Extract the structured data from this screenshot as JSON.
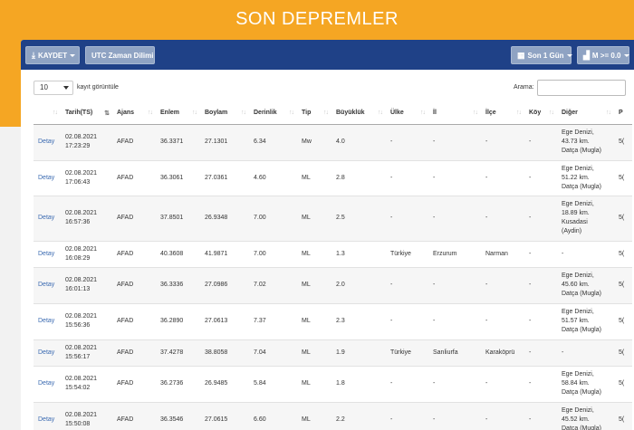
{
  "page_title": "SON DEPREMLER",
  "colors": {
    "header_bg": "#f5a623",
    "toolbar_bg": "#1f4187",
    "button_bg": "#8fa3c3",
    "link": "#3a6ab1"
  },
  "toolbar": {
    "save_label": "KAYDET",
    "save_icon": "download-icon",
    "utc_label": "UTC Zaman Dilimi",
    "period_label": "Son 1 Gün",
    "period_icon": "calendar-icon",
    "magnitude_label": "M >= 0.0",
    "magnitude_icon": "bar-chart-icon"
  },
  "controls": {
    "page_length": "10",
    "page_length_suffix": "kayıt görüntüle",
    "search_label": "Arama:",
    "search_value": ""
  },
  "columns": [
    "",
    "Tarih(TS)",
    "Ajans",
    "Enlem",
    "Boylam",
    "Derinlik",
    "Tip",
    "Büyüklük",
    "Ülke",
    "İl",
    "İlçe",
    "Köy",
    "Diğer",
    "P"
  ],
  "rows": [
    {
      "link": "Detay",
      "date": "02.08.2021",
      "time": "17:23:29",
      "agency": "AFAD",
      "lat": "36.3371",
      "lon": "27.1301",
      "depth": "6.34",
      "type": "Mw",
      "mag": "4.0",
      "country": "-",
      "city": "-",
      "district": "-",
      "village": "-",
      "other": [
        "Ege Denizi,",
        "43.73 km.",
        "Datça (Mugla)"
      ],
      "p": "5("
    },
    {
      "link": "Detay",
      "date": "02.08.2021",
      "time": "17:06:43",
      "agency": "AFAD",
      "lat": "36.3061",
      "lon": "27.0361",
      "depth": "4.60",
      "type": "ML",
      "mag": "2.8",
      "country": "-",
      "city": "-",
      "district": "-",
      "village": "-",
      "other": [
        "Ege Denizi,",
        "51.22 km.",
        "Datça (Mugla)"
      ],
      "p": "5("
    },
    {
      "link": "Detay",
      "date": "02.08.2021",
      "time": "16:57:36",
      "agency": "AFAD",
      "lat": "37.8501",
      "lon": "26.9348",
      "depth": "7.00",
      "type": "ML",
      "mag": "2.5",
      "country": "-",
      "city": "-",
      "district": "-",
      "village": "-",
      "other": [
        "Ege Denizi,",
        "18.89 km.",
        "Kusadasi",
        "(Aydin)"
      ],
      "p": "5("
    },
    {
      "link": "Detay",
      "date": "02.08.2021",
      "time": "16:08:29",
      "agency": "AFAD",
      "lat": "40.3608",
      "lon": "41.9871",
      "depth": "7.00",
      "type": "ML",
      "mag": "1.3",
      "country": "Türkiye",
      "city": "Erzurum",
      "district": "Narman",
      "village": "-",
      "other": [
        "-"
      ],
      "p": "5("
    },
    {
      "link": "Detay",
      "date": "02.08.2021",
      "time": "16:01:13",
      "agency": "AFAD",
      "lat": "36.3336",
      "lon": "27.0986",
      "depth": "7.02",
      "type": "ML",
      "mag": "2.0",
      "country": "-",
      "city": "-",
      "district": "-",
      "village": "-",
      "other": [
        "Ege Denizi,",
        "45.60 km.",
        "Datça (Mugla)"
      ],
      "p": "5("
    },
    {
      "link": "Detay",
      "date": "02.08.2021",
      "time": "15:56:36",
      "agency": "AFAD",
      "lat": "36.2890",
      "lon": "27.0613",
      "depth": "7.37",
      "type": "ML",
      "mag": "2.3",
      "country": "-",
      "city": "-",
      "district": "-",
      "village": "-",
      "other": [
        "Ege Denizi,",
        "51.57 km.",
        "Datça (Mugla)"
      ],
      "p": "5("
    },
    {
      "link": "Detay",
      "date": "02.08.2021",
      "time": "15:56:17",
      "agency": "AFAD",
      "lat": "37.4278",
      "lon": "38.8058",
      "depth": "7.04",
      "type": "ML",
      "mag": "1.9",
      "country": "Türkiye",
      "city": "Sanliurfa",
      "district": "Karaköprü",
      "village": "-",
      "other": [
        "-"
      ],
      "p": "5("
    },
    {
      "link": "Detay",
      "date": "02.08.2021",
      "time": "15:54:02",
      "agency": "AFAD",
      "lat": "36.2736",
      "lon": "26.9485",
      "depth": "5.84",
      "type": "ML",
      "mag": "1.8",
      "country": "-",
      "city": "-",
      "district": "-",
      "village": "-",
      "other": [
        "Ege Denizi,",
        "58.84 km.",
        "Datça (Mugla)"
      ],
      "p": "5("
    },
    {
      "link": "Detay",
      "date": "02.08.2021",
      "time": "15:50:08",
      "agency": "AFAD",
      "lat": "36.3546",
      "lon": "27.0615",
      "depth": "6.60",
      "type": "ML",
      "mag": "2.2",
      "country": "-",
      "city": "-",
      "district": "-",
      "village": "-",
      "other": [
        "Ege Denizi,",
        "45.52 km.",
        "Datça (Mugla)"
      ],
      "p": "5("
    }
  ]
}
